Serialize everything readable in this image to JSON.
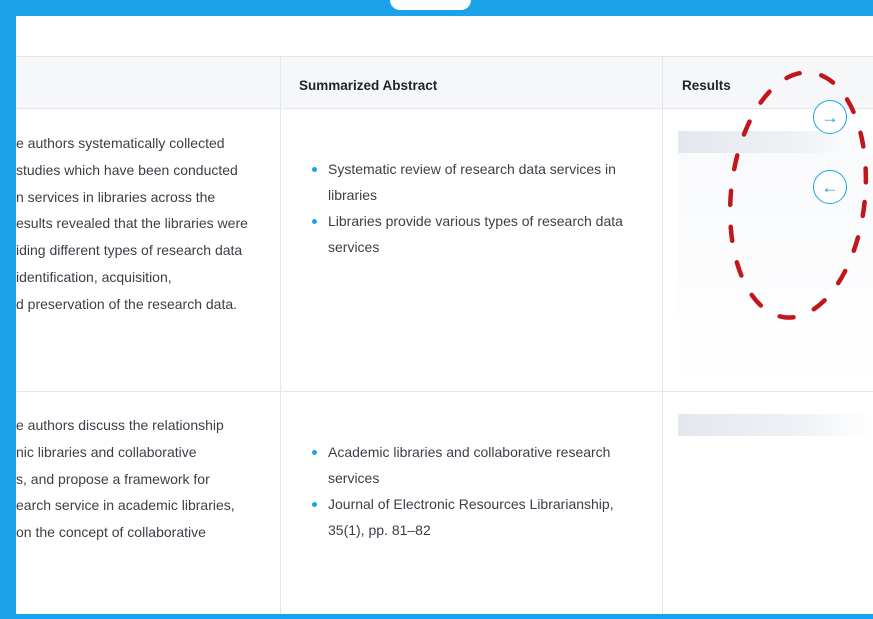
{
  "table": {
    "headers": {
      "summarized_abstract": "Summarized Abstract",
      "results": "Results"
    },
    "rows": [
      {
        "paper_lines": [
          "e authors systematically collected",
          " studies which have been conducted",
          "n services in libraries across the",
          "esults revealed that the libraries were",
          "iding different types of research data",
          "identification, acquisition,",
          "d preservation of the research data."
        ],
        "abstract_items": [
          "Systematic review of research data services in libraries",
          "Libraries provide various types of research data services"
        ]
      },
      {
        "paper_lines": [
          "e authors discuss the relationship",
          "nic libraries and collaborative",
          "s, and propose a framework for",
          "earch service in academic libraries,",
          "on the concept of collaborative"
        ],
        "abstract_items": [
          "Academic libraries and collaborative research services",
          "Journal of Electronic Resources Librarianship, 35(1), pp. 81–82"
        ]
      }
    ]
  },
  "scroll_controls": {
    "right_icon": "arrow-right-icon",
    "left_icon": "arrow-left-icon",
    "right_glyph": "→",
    "left_glyph": "←"
  },
  "colors": {
    "frame_blue": "#1aa3ea",
    "annotation_red": "#c0161c",
    "bullet": "#1aa3ea"
  }
}
